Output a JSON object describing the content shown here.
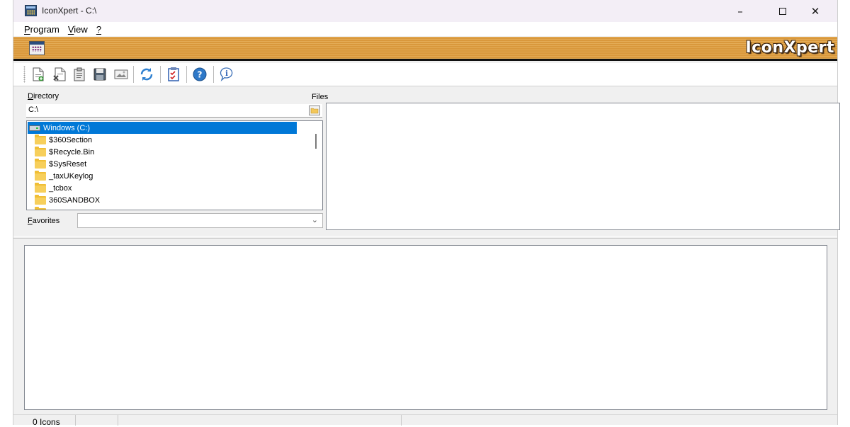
{
  "window": {
    "title": "IconXpert - C:\\",
    "controls": {
      "minimize": "–",
      "close": "✕"
    }
  },
  "menu": {
    "program": {
      "accel": "P",
      "rest": "rogram"
    },
    "view": {
      "accel": "V",
      "rest": "iew"
    },
    "help": {
      "accel": "?",
      "rest": ""
    }
  },
  "banner": {
    "brand": "IconXpert"
  },
  "toolbar": {
    "buttons": [
      "new-document-icon",
      "delete-document-icon",
      "clipboard-icon",
      "save-icon",
      "image-icon",
      "refresh-icon",
      "checklist-icon",
      "help-icon",
      "info-icon"
    ]
  },
  "directory": {
    "label": {
      "accel": "D",
      "rest": "irectory"
    },
    "value": "C:\\"
  },
  "tree": {
    "items": [
      {
        "label": "Windows (C:)",
        "type": "drive",
        "selected": true
      },
      {
        "label": "$360Section",
        "type": "folder"
      },
      {
        "label": "$Recycle.Bin",
        "type": "folder"
      },
      {
        "label": "$SysReset",
        "type": "folder"
      },
      {
        "label": "_taxUKeylog",
        "type": "folder"
      },
      {
        "label": "_tcbox",
        "type": "folder"
      },
      {
        "label": "360SANDBOX",
        "type": "folder"
      }
    ]
  },
  "favorites": {
    "label": {
      "accel": "F",
      "rest": "avorites"
    },
    "value": ""
  },
  "files": {
    "label": "Files"
  },
  "status": {
    "icon_count": "0 Icons",
    "cell2": "",
    "cell3": ""
  }
}
